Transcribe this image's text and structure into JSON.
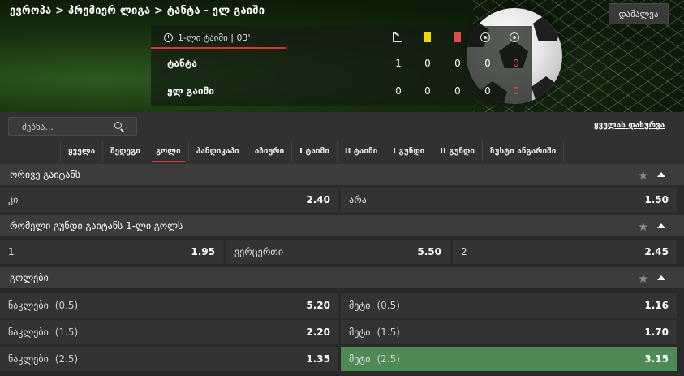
{
  "breadcrumb": "ევროპა > პრემიერ ლიგა > ტანტა - ელ გაიში",
  "hide_button": "დამალვა",
  "match": {
    "period": "1-ლი ტაიმი | 03'",
    "home": {
      "name": "ტანტა",
      "score": "1",
      "yellow": "0",
      "red": "0",
      "stat4": "0",
      "stat5": "0"
    },
    "away": {
      "name": "ელ გაიში",
      "score": "0",
      "yellow": "0",
      "red": "0",
      "stat4": "0",
      "stat5": "0"
    },
    "icons": [
      "corner-icon",
      "yellow-card-icon",
      "red-card-icon",
      "penalty-icon",
      "goal-icon"
    ],
    "highlight_color": "#e34b4b"
  },
  "search": {
    "placeholder": "ძებნა..."
  },
  "close_all": "ყველას დახურვა",
  "tabs": [
    "ყველა",
    "შედეგი",
    "გოლი",
    "ჰანდიკაპი",
    "აზიური",
    "I ტაიმი",
    "II ტაიმი",
    "I გუნდი",
    "II გუნდი",
    "ზუსტი ანგარიში"
  ],
  "active_tab": "გოლი",
  "markets": {
    "both_score": {
      "title": "ორივე გაიტანს",
      "yes": {
        "label": "კი",
        "price": "2.40"
      },
      "no": {
        "label": "არა",
        "price": "1.50"
      }
    },
    "first_goal": {
      "title": "რომელი გუნდი გაიტანს 1-ლი გოლს",
      "home": {
        "label": "1",
        "price": "1.95"
      },
      "none": {
        "label": "ვერცერთი",
        "price": "5.50"
      },
      "away": {
        "label": "2",
        "price": "2.45"
      }
    },
    "goals": {
      "title": "გოლები",
      "rows": [
        {
          "under_label": "ნაკლები",
          "under_line": "(0.5)",
          "under_price": "5.20",
          "over_label": "მეტი",
          "over_line": "(0.5)",
          "over_price": "1.16"
        },
        {
          "under_label": "ნაკლები",
          "under_line": "(1.5)",
          "under_price": "2.20",
          "over_label": "მეტი",
          "over_line": "(1.5)",
          "over_price": "1.70"
        },
        {
          "under_label": "ნაკლები",
          "under_line": "(2.5)",
          "under_price": "1.35",
          "over_label": "მეტი",
          "over_line": "(2.5)",
          "over_price": "3.15"
        }
      ],
      "selected_color": "#4e8a55"
    }
  }
}
